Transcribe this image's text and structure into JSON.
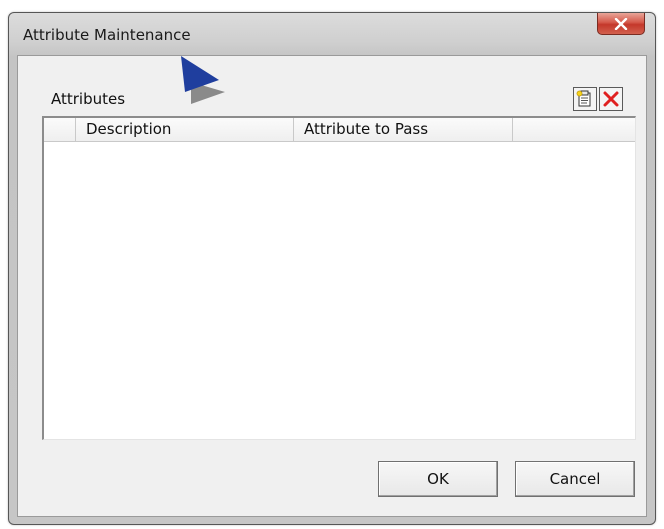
{
  "window": {
    "title": "Attribute Maintenance",
    "close_glyph": "x"
  },
  "attributes": {
    "label": "Attributes",
    "toolbar": {
      "new_icon": "new-record-icon",
      "delete_icon": "delete-x-icon"
    },
    "columns": [
      "",
      "Description",
      "Attribute to Pass",
      ""
    ],
    "rows": []
  },
  "buttons": {
    "ok": "OK",
    "cancel": "Cancel"
  },
  "colors": {
    "close_button": "#c94a3c",
    "delete_icon": "#e02020",
    "cursor": "#1f3e9e"
  }
}
